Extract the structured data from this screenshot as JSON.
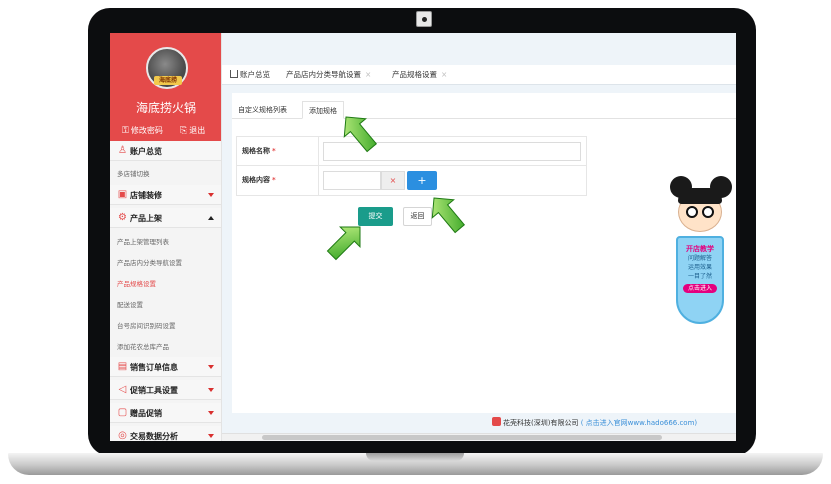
{
  "sidebar": {
    "shop_name": "海底捞火锅",
    "avatar_tag": "海底捞",
    "change_password": "修改密码",
    "logout": "退出",
    "sections": [
      {
        "label": "账户总览",
        "icon": "user-icon"
      },
      {
        "label": "店铺装修",
        "icon": "store-icon"
      },
      {
        "label": "产品上架",
        "icon": "gear-icon"
      },
      {
        "label": "销售订单信息",
        "icon": "order-icon"
      },
      {
        "label": "促销工具设置",
        "icon": "megaphone-icon"
      },
      {
        "label": "赠品促销",
        "icon": "gift-icon"
      },
      {
        "label": "交易数据分析",
        "icon": "chart-icon"
      }
    ],
    "sub_items": {
      "multi_store_switch": "多店铺切换",
      "product_list": "产品上架管理列表",
      "category_nav": "产品店内分类导航设置",
      "spec_settings": "产品规格设置",
      "delivery": "配送设置",
      "table_qr": "台号房间识别码设置",
      "add_flower": "添加花农总库产品"
    },
    "accent_color": "#e44a4a"
  },
  "tabs": {
    "home": "账户总览",
    "category_nav": "产品店内分类导航设置",
    "spec": "产品规格设置"
  },
  "subtabs": {
    "list": "自定义规格列表",
    "add": "添加规格"
  },
  "form": {
    "name_label": "规格名称",
    "content_label": "规格内容",
    "required_mark": "*",
    "name_value": "",
    "content_value": "",
    "clear": "×",
    "add": "+"
  },
  "buttons": {
    "submit": "提交",
    "back": "返回"
  },
  "footer": {
    "company": "花壳科技(深圳)有限公司",
    "link_text": "( 点击进入官网www.hado666.com)"
  },
  "mascot": {
    "title": "开店教学",
    "lines": [
      "问题解答",
      "运用效果",
      "一目了然"
    ],
    "enter": "点击进入"
  }
}
